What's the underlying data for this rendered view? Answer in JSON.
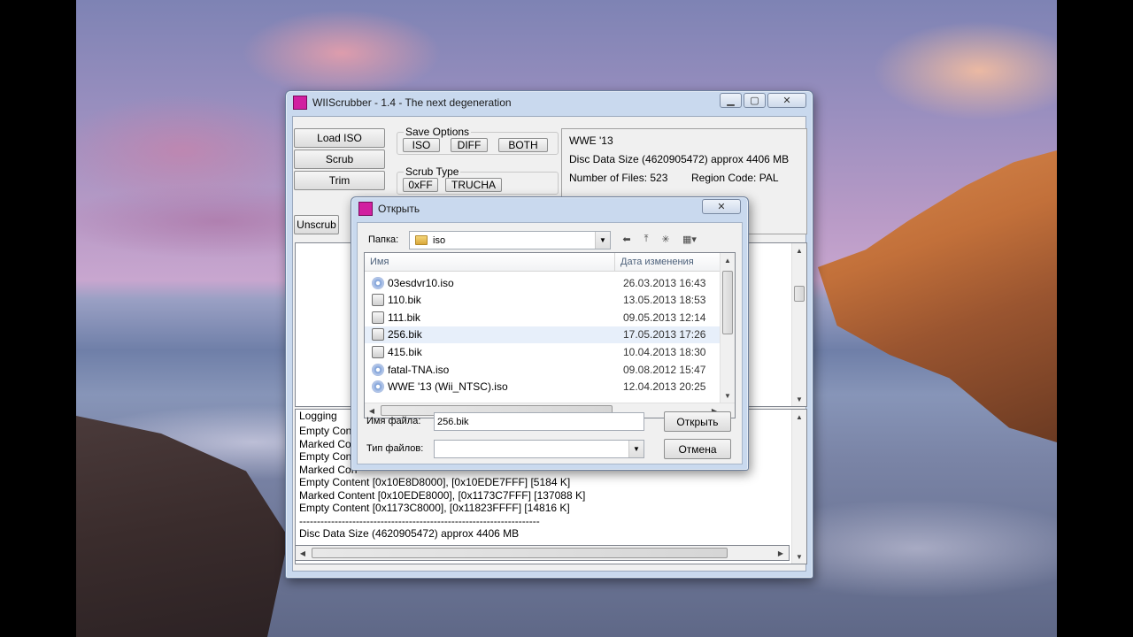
{
  "main_window": {
    "title": "WIIScrubber - 1.4 - The next degeneration",
    "buttons": {
      "load_iso": "Load ISO",
      "scrub": "Scrub",
      "trim": "Trim",
      "unscrub": "Unscrub"
    },
    "save_options": {
      "label": "Save Options",
      "iso": "ISO",
      "diff": "DIFF",
      "both": "BOTH"
    },
    "scrub_type": {
      "label": "Scrub Type",
      "oxff": "0xFF",
      "trucha": "TRUCHA"
    },
    "info": {
      "game_title": "WWE '13",
      "disc_size": "Disc Data Size (4620905472) approx  4406 MB",
      "num_files": "Number of Files: 523",
      "region": "Region Code: PAL"
    },
    "logging": {
      "label": "Logging",
      "lines": [
        "Empty Content",
        "Marked Con",
        "Empty Content",
        "Marked Con",
        "Empty Content [0x10E8D8000], [0x10EDE7FFF] [5184 K]",
        "Marked Content [0x10EDE8000], [0x1173C7FFF] [137088 K]",
        "Empty Content [0x1173C8000], [0x11823FFFF] [14816 K]",
        "--------------------------------------------------------------------",
        "Disc Data Size (4620905472) approx  4406 MB"
      ]
    }
  },
  "open_dialog": {
    "title": "Открыть",
    "folder_label": "Папка:",
    "folder_value": "iso",
    "columns": {
      "name": "Имя",
      "date": "Дата изменения"
    },
    "files": [
      {
        "name": "03esdvr10.iso",
        "date": "26.03.2013 16:43",
        "type": "iso"
      },
      {
        "name": "110.bik",
        "date": "13.05.2013 18:53",
        "type": "bik"
      },
      {
        "name": "111.bik",
        "date": "09.05.2013 12:14",
        "type": "bik"
      },
      {
        "name": "256.bik",
        "date": "17.05.2013 17:26",
        "type": "bik"
      },
      {
        "name": "415.bik",
        "date": "10.04.2013 18:30",
        "type": "bik"
      },
      {
        "name": "fatal-TNA.iso",
        "date": "09.08.2012 15:47",
        "type": "iso"
      },
      {
        "name": "WWE '13 (Wii_NTSC).iso",
        "date": "12.04.2013 20:25",
        "type": "iso"
      }
    ],
    "filename_label": "Имя файла:",
    "filename_value": "256.bik",
    "filetype_label": "Тип файлов:",
    "filetype_value": "",
    "open_button": "Открыть",
    "cancel_button": "Отмена"
  }
}
